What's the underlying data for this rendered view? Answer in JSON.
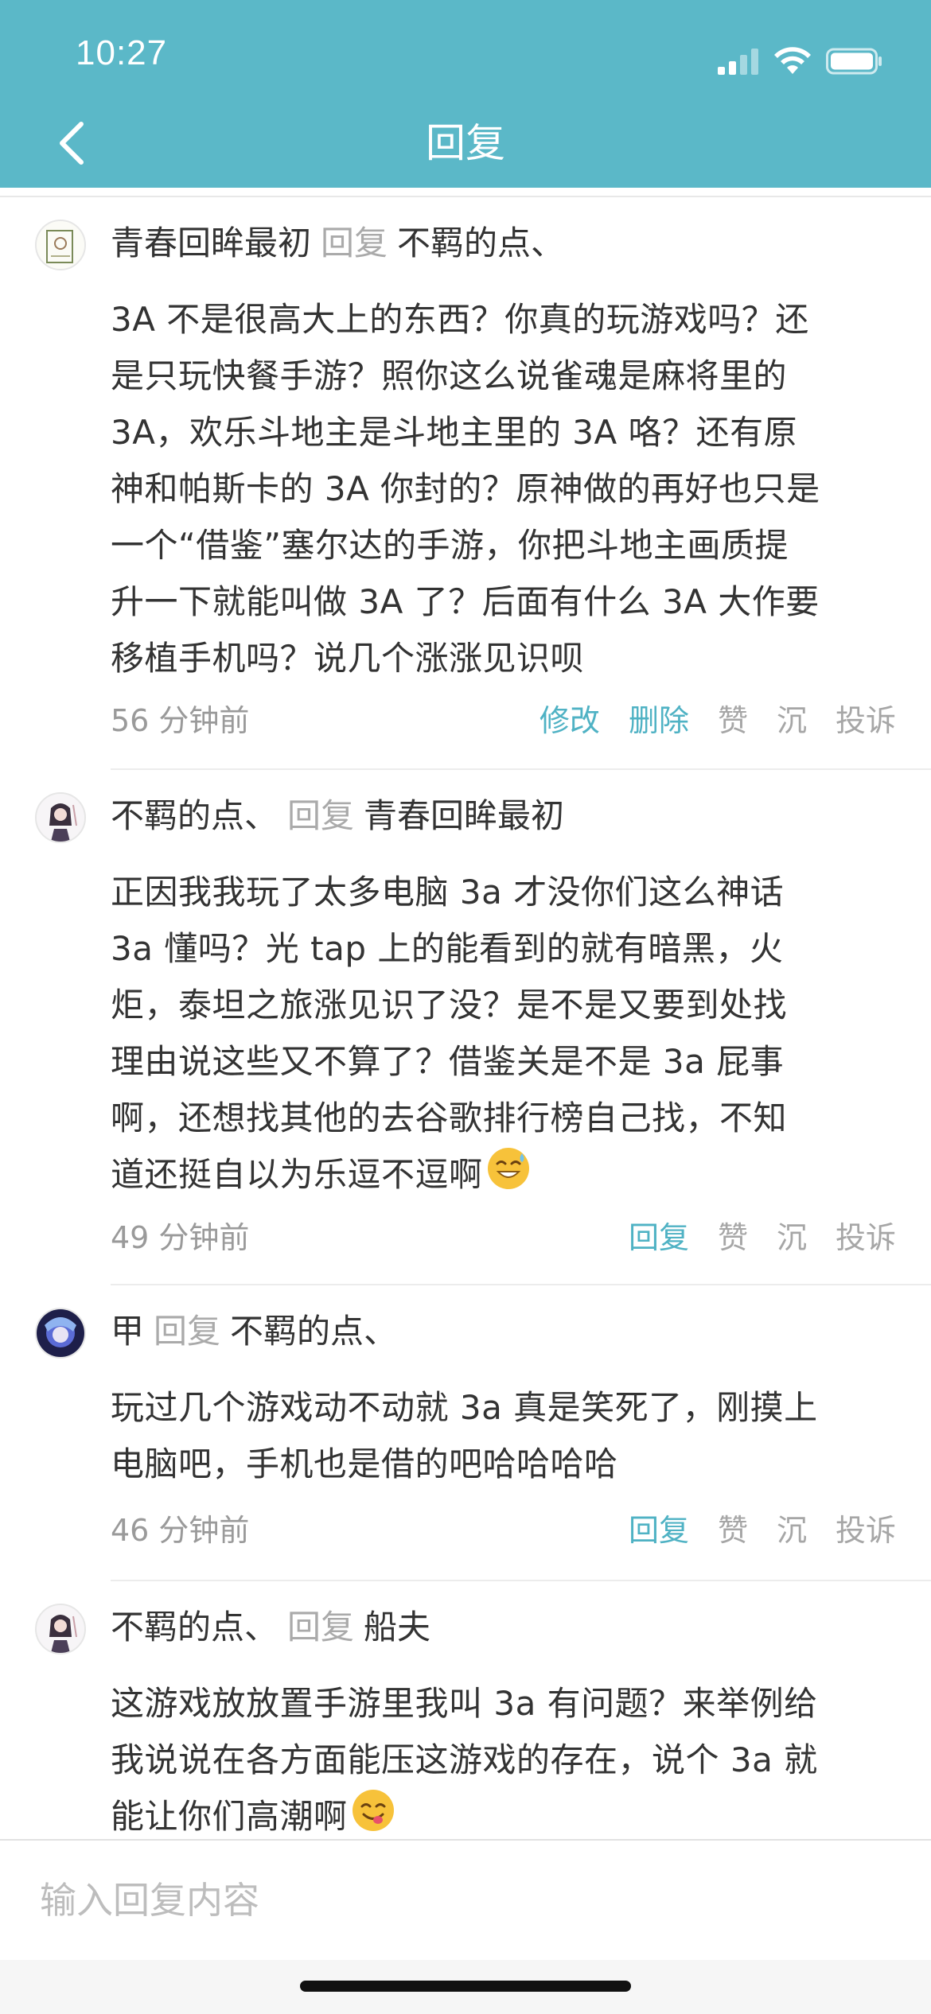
{
  "status_bar": {
    "time": "10:27"
  },
  "nav": {
    "title": "回复"
  },
  "input": {
    "placeholder": "输入回复内容"
  },
  "posts": [
    {
      "user": "青春回眸最初",
      "reply_word": "回复",
      "target": "不羁的点、",
      "lines": [
        "3A 不是很高大上的东西？你真的玩游戏吗？还",
        "是只玩快餐手游？照你这么说雀魂是麻将里的",
        "3A，欢乐斗地主是斗地主里的 3A 咯？还有原",
        "神和帕斯卡的 3A 你封的？原神做的再好也只是",
        "一个“借鉴”塞尔达的手游，你把斗地主画质提",
        "升一下就能叫做 3A 了？后面有什么 3A 大作要",
        "移植手机吗？说几个涨涨见识呗"
      ],
      "time": "56 分钟前",
      "actions": [
        "修改",
        "删除",
        "赞",
        "沉",
        "投诉"
      ]
    },
    {
      "user": "不羁的点、",
      "reply_word": "回复",
      "target": "青春回眸最初",
      "lines": [
        "正因我我玩了太多电脑 3a 才没你们这么神话",
        "3a 懂吗？光 tap 上的能看到的就有暗黑，火",
        "炬，泰坦之旅涨见识了没？是不是又要到处找",
        "理由说这些又不算了？借鉴关是不是 3a 屁事",
        "啊，还想找其他的去谷歌排行榜自己找，不知",
        "道还挺自以为乐逗不逗啊"
      ],
      "emoji": "grinning-sweat-emoji",
      "time": "49 分钟前",
      "actions": [
        "回复",
        "赞",
        "沉",
        "投诉"
      ]
    },
    {
      "user": "甲",
      "reply_word": "回复",
      "target": "不羁的点、",
      "lines": [
        "玩过几个游戏动不动就 3a 真是笑死了，刚摸上",
        "电脑吧，手机也是借的吧哈哈哈哈"
      ],
      "time": "46 分钟前",
      "actions": [
        "回复",
        "赞",
        "沉",
        "投诉"
      ]
    },
    {
      "user": "不羁的点、",
      "reply_word": "回复",
      "target": "船夫",
      "lines": [
        "这游戏放放置手游里我叫 3a 有问题？来举例给",
        "我说说在各方面能压这游戏的存在，说个 3a 就",
        "能让你们高潮啊"
      ],
      "emoji": "yum-emoji"
    }
  ],
  "colors": {
    "header": "#5bb8c8",
    "action_blue": "#4fb2c4",
    "muted": "#a6a6a6"
  }
}
